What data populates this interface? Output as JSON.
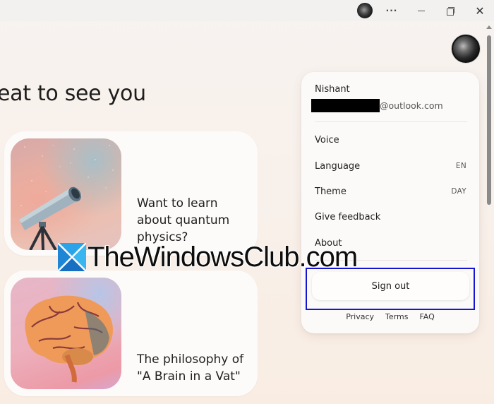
{
  "titlebar": {
    "more_label": "···",
    "minimize_label": "",
    "maximize_label": "",
    "close_label": "✕"
  },
  "main": {
    "greeting": "eat to see you",
    "cards": [
      {
        "text": "Want to learn about quantum physics?",
        "image": "telescope"
      },
      {
        "text": "The philosophy of \"A Brain in a Vat\"",
        "image": "brain"
      }
    ]
  },
  "account_menu": {
    "user_name": "Nishant",
    "email_domain": "@outlook.com",
    "items": [
      {
        "label": "Voice",
        "value": ""
      },
      {
        "label": "Language",
        "value": "EN"
      },
      {
        "label": "Theme",
        "value": "DAY"
      },
      {
        "label": "Give feedback",
        "value": ""
      },
      {
        "label": "About",
        "value": ""
      }
    ],
    "sign_out_label": "Sign out",
    "footer_links": [
      "Privacy",
      "Terms",
      "FAQ"
    ]
  },
  "watermark": {
    "text": "TheWindowsClub.com"
  },
  "colors": {
    "highlight_border": "#1515d0",
    "background": "#f8f0ea",
    "panel": "#fcfaf8"
  }
}
